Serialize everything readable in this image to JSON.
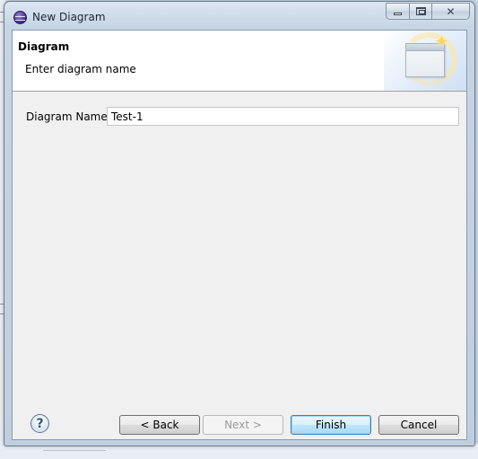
{
  "window": {
    "title": "New Diagram",
    "min_label": "",
    "max_label": "",
    "close_label": "✕"
  },
  "wizard": {
    "page_title": "Diagram",
    "page_description": "Enter diagram name"
  },
  "form": {
    "diagram_name_label": "Diagram Name",
    "diagram_name_value": "Test-1"
  },
  "buttons": {
    "help_label": "?",
    "back_label": "< Back",
    "next_label": "Next >",
    "finish_label": "Finish",
    "cancel_label": "Cancel",
    "next_enabled": false,
    "default_button": "finish"
  },
  "icons": {
    "app": "eclipse-icon",
    "wizard_banner": "new-diagram-wizard-icon",
    "help": "help-icon"
  },
  "colors": {
    "client_background": "#f0f0f0",
    "banner_background": "#ffffff",
    "default_button_border": "#3c7fb1",
    "disabled_text": "#9a9a9a"
  }
}
